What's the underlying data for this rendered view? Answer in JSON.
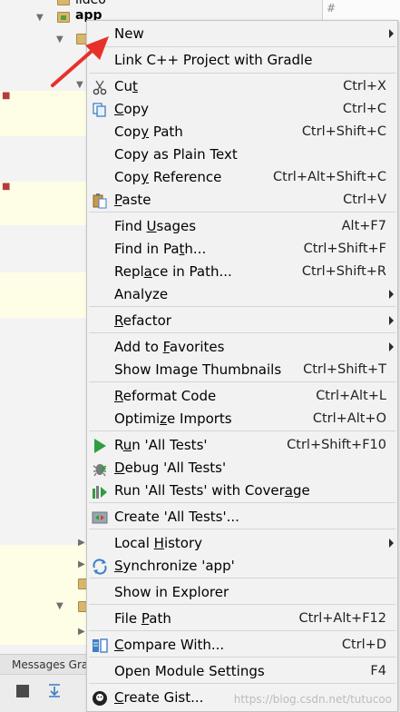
{
  "tree": {
    "row_top": "lideo",
    "row_app": "app"
  },
  "editor_marks": [
    "#",
    "#",
    "#",
    "#",
    "#"
  ],
  "messages_tab": "Messages Gra",
  "menu": {
    "items": [
      {
        "label": "New",
        "shortcut": "",
        "submenu": true,
        "icon": "none"
      },
      {
        "label": "Link C++ Project with Gradle",
        "shortcut": "",
        "submenu": false,
        "icon": "none"
      },
      {
        "label": "Cut",
        "shortcut": "Ctrl+X",
        "submenu": false,
        "icon": "scissors-icon"
      },
      {
        "label": "Copy",
        "shortcut": "Ctrl+C",
        "submenu": false,
        "icon": "copy-icon"
      },
      {
        "label": "Copy Path",
        "shortcut": "Ctrl+Shift+C",
        "submenu": false,
        "icon": "none"
      },
      {
        "label": "Copy as Plain Text",
        "shortcut": "",
        "submenu": false,
        "icon": "none"
      },
      {
        "label": "Copy Reference",
        "shortcut": "Ctrl+Alt+Shift+C",
        "submenu": false,
        "icon": "none"
      },
      {
        "label": "Paste",
        "shortcut": "Ctrl+V",
        "submenu": false,
        "icon": "paste-icon"
      },
      {
        "label": "Find Usages",
        "shortcut": "Alt+F7",
        "submenu": false,
        "icon": "none"
      },
      {
        "label": "Find in Path...",
        "shortcut": "Ctrl+Shift+F",
        "submenu": false,
        "icon": "none"
      },
      {
        "label": "Replace in Path...",
        "shortcut": "Ctrl+Shift+R",
        "submenu": false,
        "icon": "none"
      },
      {
        "label": "Analyze",
        "shortcut": "",
        "submenu": true,
        "icon": "none"
      },
      {
        "label": "Refactor",
        "shortcut": "",
        "submenu": true,
        "icon": "none"
      },
      {
        "label": "Add to Favorites",
        "shortcut": "",
        "submenu": true,
        "icon": "none"
      },
      {
        "label": "Show Image Thumbnails",
        "shortcut": "Ctrl+Shift+T",
        "submenu": false,
        "icon": "none"
      },
      {
        "label": "Reformat Code",
        "shortcut": "Ctrl+Alt+L",
        "submenu": false,
        "icon": "none"
      },
      {
        "label": "Optimize Imports",
        "shortcut": "Ctrl+Alt+O",
        "submenu": false,
        "icon": "none"
      },
      {
        "label": "Run 'All Tests'",
        "shortcut": "Ctrl+Shift+F10",
        "submenu": false,
        "icon": "run-icon"
      },
      {
        "label": "Debug 'All Tests'",
        "shortcut": "",
        "submenu": false,
        "icon": "debug-icon"
      },
      {
        "label": "Run 'All Tests' with Coverage",
        "shortcut": "",
        "submenu": false,
        "icon": "coverage-icon"
      },
      {
        "label": "Create 'All Tests'...",
        "shortcut": "",
        "submenu": false,
        "icon": "create-test-icon"
      },
      {
        "label": "Local History",
        "shortcut": "",
        "submenu": true,
        "icon": "none"
      },
      {
        "label": "Synchronize 'app'",
        "shortcut": "",
        "submenu": false,
        "icon": "sync-icon"
      },
      {
        "label": "Show in Explorer",
        "shortcut": "",
        "submenu": false,
        "icon": "none"
      },
      {
        "label": "File Path",
        "shortcut": "Ctrl+Alt+F12",
        "submenu": false,
        "icon": "none"
      },
      {
        "label": "Compare With...",
        "shortcut": "Ctrl+D",
        "submenu": false,
        "icon": "compare-icon"
      },
      {
        "label": "Open Module Settings",
        "shortcut": "F4",
        "submenu": false,
        "icon": "none"
      },
      {
        "label": "Create Gist...",
        "shortcut": "",
        "submenu": false,
        "icon": "github-icon"
      }
    ]
  },
  "watermark": "https://blog.csdn.net/tutucoo",
  "colors": {
    "menu_bg": "#f2f2f2",
    "separator": "#d4d4d4",
    "arrow": "#e8302a",
    "run_green": "#2e9e3f",
    "sync_blue": "#3f7fc8"
  }
}
